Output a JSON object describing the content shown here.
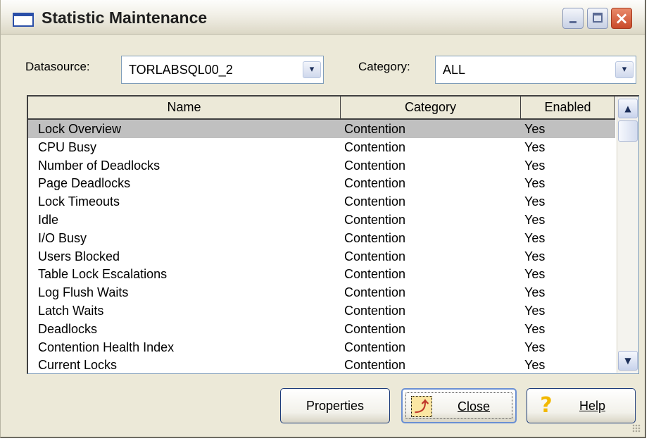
{
  "window": {
    "title": "Statistic Maintenance",
    "minimize_label": "_",
    "maximize_label": "□",
    "close_label": "×"
  },
  "filters": {
    "datasource_label": "Datasource:",
    "datasource_value": "TORLABSQL00_2",
    "category_label": "Category:",
    "category_value": "ALL",
    "dropdown_glyph": "▾"
  },
  "list": {
    "columns": [
      "Name",
      "Category",
      "Enabled"
    ],
    "rows": [
      {
        "name": "Lock Overview",
        "category": "Contention",
        "enabled": "Yes",
        "selected": true
      },
      {
        "name": "CPU Busy",
        "category": "Contention",
        "enabled": "Yes"
      },
      {
        "name": "Number of Deadlocks",
        "category": "Contention",
        "enabled": "Yes"
      },
      {
        "name": "Page Deadlocks",
        "category": "Contention",
        "enabled": "Yes"
      },
      {
        "name": "Lock Timeouts",
        "category": "Contention",
        "enabled": "Yes"
      },
      {
        "name": "Idle",
        "category": "Contention",
        "enabled": "Yes"
      },
      {
        "name": "I/O Busy",
        "category": "Contention",
        "enabled": "Yes"
      },
      {
        "name": "Users Blocked",
        "category": "Contention",
        "enabled": "Yes"
      },
      {
        "name": "Table Lock Escalations",
        "category": "Contention",
        "enabled": "Yes"
      },
      {
        "name": "Log Flush Waits",
        "category": "Contention",
        "enabled": "Yes"
      },
      {
        "name": "Latch Waits",
        "category": "Contention",
        "enabled": "Yes"
      },
      {
        "name": "Deadlocks",
        "category": "Contention",
        "enabled": "Yes"
      },
      {
        "name": "Contention Health Index",
        "category": "Contention",
        "enabled": "Yes"
      },
      {
        "name": "Current Locks",
        "category": "Contention",
        "enabled": "Yes"
      }
    ],
    "scroll_up_glyph": "▲",
    "scroll_down_glyph": "▼"
  },
  "buttons": {
    "properties": "Properties",
    "close": "Close",
    "help": "Help",
    "close_icon": "exit-runner-icon",
    "help_icon": "question-mark-icon",
    "help_glyph": "?",
    "close_glyph": "⤴"
  },
  "colors": {
    "selection": "#c0c0c0",
    "dialog_bg": "#ece9d8",
    "border_blue": "#7f9db9"
  }
}
